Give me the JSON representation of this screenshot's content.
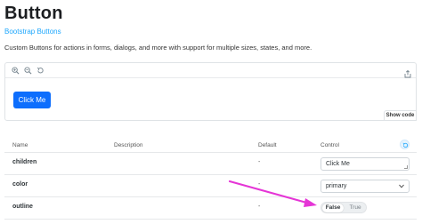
{
  "page": {
    "title": "Button",
    "subtitle_link": "Bootstrap Buttons",
    "description": "Custom Buttons for actions in forms, dialogs, and more with support for multiple sizes, states, and more."
  },
  "toolbar": {
    "icons": [
      "zoom-in-icon",
      "zoom-out-icon",
      "zoom-reset-icon",
      "share-icon"
    ]
  },
  "preview": {
    "button_label": "Click Me",
    "show_code_label": "Show code"
  },
  "table": {
    "headers": {
      "name": "Name",
      "description": "Description",
      "default": "Default",
      "control": "Control"
    },
    "rows": [
      {
        "name": "children",
        "default": "-",
        "control_value": "Click Me"
      },
      {
        "name": "color",
        "default": "-",
        "control_value": "primary"
      },
      {
        "name": "outline",
        "default": "-",
        "toggle_false": "False",
        "toggle_true": "True",
        "selected": "False"
      }
    ]
  },
  "colors": {
    "primary_button": "#0d6efd",
    "link": "#1ea7fd",
    "annotation_arrow": "#e535d6"
  }
}
